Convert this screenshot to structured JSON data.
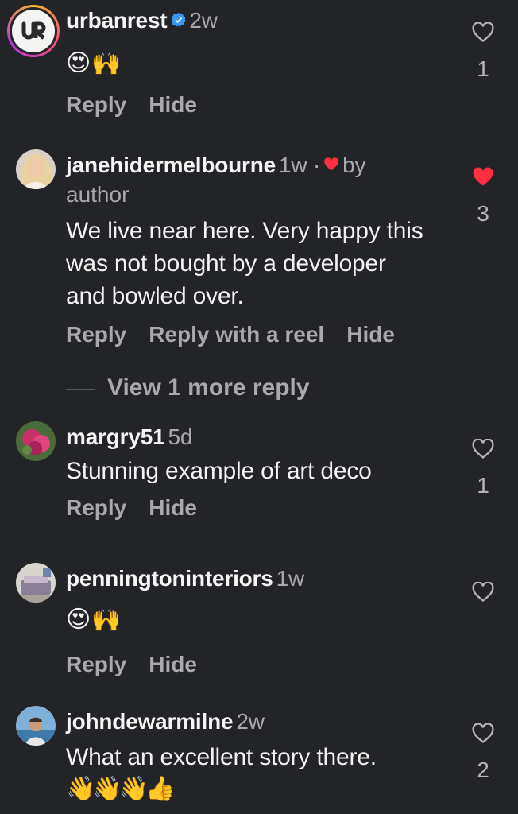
{
  "colors": {
    "background": "#232428",
    "text_primary": "#f3f3f3",
    "text_secondary": "#a8a8ad",
    "verified_blue": "#3897f0",
    "liked_red": "#ff3040"
  },
  "comments": [
    {
      "username": "urbanrest",
      "verified": true,
      "time": "2w",
      "emoji": "😍🙌",
      "actions": [
        "Reply",
        "Hide"
      ],
      "like_count": "1",
      "liked": false,
      "avatar_icon": "urbanrest-logo-icon",
      "avatar_text": "UR"
    },
    {
      "username": "janehidermelbourne",
      "time": "1w ·",
      "by_author": "by",
      "author_word": "author",
      "text": "We live near here. Very happy this was not bought by a developer and bowled over.",
      "actions": [
        "Reply",
        "Reply with a reel",
        "Hide"
      ],
      "like_count": "3",
      "liked": true
    },
    {
      "username": "margry51",
      "time": "5d",
      "text": "Stunning example of art deco",
      "actions": [
        "Reply",
        "Hide"
      ],
      "like_count": "1",
      "liked": false
    },
    {
      "username": "penningtoninteriors",
      "time": "1w",
      "emoji": "😍🙌",
      "actions": [
        "Reply",
        "Hide"
      ],
      "like_count": "",
      "liked": false
    },
    {
      "username": "johndewarmilne",
      "time": "2w",
      "text": "What an excellent story there.",
      "emoji": "👋👋👋👍",
      "like_count": "2",
      "liked": false
    }
  ],
  "view_more": "View 1 more reply"
}
